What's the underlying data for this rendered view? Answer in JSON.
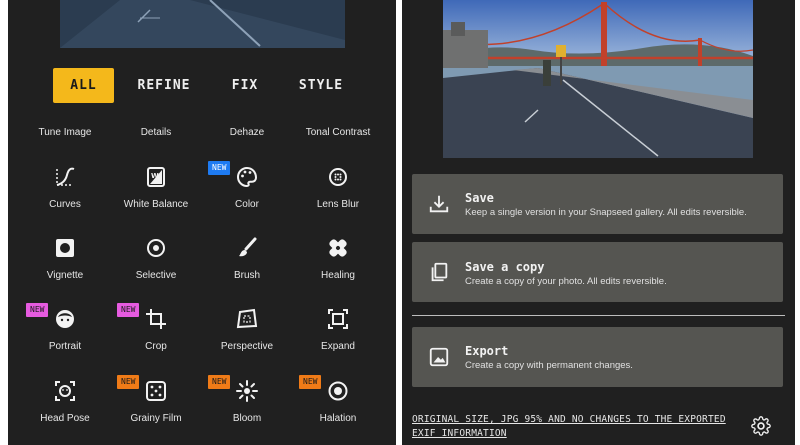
{
  "filters": {
    "tabs": [
      {
        "label": "ALL",
        "active": true
      },
      {
        "label": "REFINE",
        "active": false
      },
      {
        "label": "FIX",
        "active": false
      },
      {
        "label": "STYLE",
        "active": false
      }
    ],
    "accent_color": "#f4b81b",
    "tools": [
      {
        "label": "Tune Image",
        "icon": "sliders-icon"
      },
      {
        "label": "Details",
        "icon": "triangle-icon"
      },
      {
        "label": "Dehaze",
        "icon": "haze-icon"
      },
      {
        "label": "Tonal Contrast",
        "icon": "contrast-icon"
      },
      {
        "label": "Curves",
        "icon": "curves-icon"
      },
      {
        "label": "White Balance",
        "icon": "white-balance-icon"
      },
      {
        "label": "Color",
        "icon": "palette-icon",
        "badge": "NEW"
      },
      {
        "label": "Lens Blur",
        "icon": "lens-blur-icon"
      },
      {
        "label": "Vignette",
        "icon": "vignette-icon"
      },
      {
        "label": "Selective",
        "icon": "selective-icon"
      },
      {
        "label": "Brush",
        "icon": "brush-icon"
      },
      {
        "label": "Healing",
        "icon": "healing-icon"
      },
      {
        "label": "Portrait",
        "icon": "portrait-icon",
        "badge": "NEW"
      },
      {
        "label": "Crop",
        "icon": "crop-icon",
        "badge": "NEW"
      },
      {
        "label": "Perspective",
        "icon": "perspective-icon"
      },
      {
        "label": "Expand",
        "icon": "expand-icon"
      },
      {
        "label": "Head Pose",
        "icon": "head-pose-icon"
      },
      {
        "label": "Grainy Film",
        "icon": "grainy-film-icon",
        "badge": "NEW"
      },
      {
        "label": "Bloom",
        "icon": "bloom-icon",
        "badge": "NEW"
      },
      {
        "label": "Halation",
        "icon": "halation-icon",
        "badge": "NEW"
      }
    ],
    "badge_colors": {
      "blue": "#1e7bf2",
      "pink": "#e65be0",
      "orange": "#f07b17"
    }
  },
  "export": {
    "options": [
      {
        "title": "Save",
        "description": "Keep a single version in your Snapseed gallery. All edits reversible.",
        "icon": "download-icon"
      },
      {
        "title": "Save a copy",
        "description": "Create a copy of your photo. All edits reversible.",
        "icon": "copy-icon"
      },
      {
        "title": "Export",
        "description": "Create a copy with permanent changes.",
        "icon": "image-icon"
      }
    ],
    "footer": "ORIGINAL SIZE, JPG 95% AND NO CHANGES TO THE EXPORTED EXIF INFORMATION",
    "settings_icon": "gear-icon"
  }
}
